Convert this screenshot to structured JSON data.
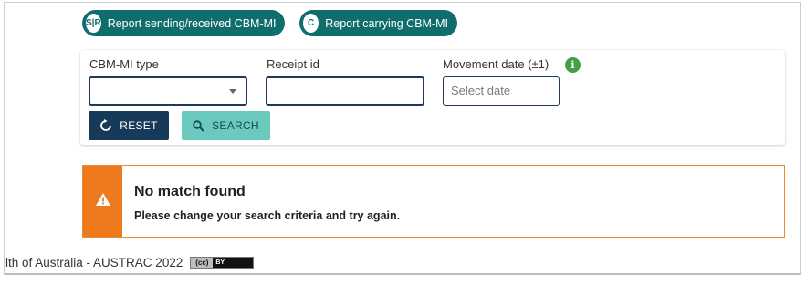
{
  "tabs": [
    {
      "badge": "S|R",
      "label": "Report sending/received CBM-MI"
    },
    {
      "badge": "C",
      "label": "Report carrying CBM-MI"
    }
  ],
  "form": {
    "type_label": "CBM-MI type",
    "type_value": "",
    "receipt_label": "Receipt id",
    "receipt_value": "",
    "date_label": "Movement date (±1)",
    "date_placeholder": "Select date",
    "info_glyph": "i"
  },
  "buttons": {
    "reset": "RESET",
    "search": "SEARCH"
  },
  "alert": {
    "title": "No match found",
    "message": "Please change your search criteria and try again."
  },
  "footer": {
    "text": "lth of Australia - AUSTRAC 2022",
    "cc_left": "(cc)",
    "cc_right": "BY"
  },
  "colors": {
    "tab_bg": "#0f6d6c",
    "reset_bg": "#173a5a",
    "search_bg": "#6cc9be",
    "alert_accent": "#ef7a1e",
    "info": "#43a047"
  },
  "icons": {
    "reset": "refresh-icon",
    "search": "search-icon",
    "alert": "warning-icon",
    "info": "info-icon",
    "dropdown": "chevron-down-icon"
  }
}
